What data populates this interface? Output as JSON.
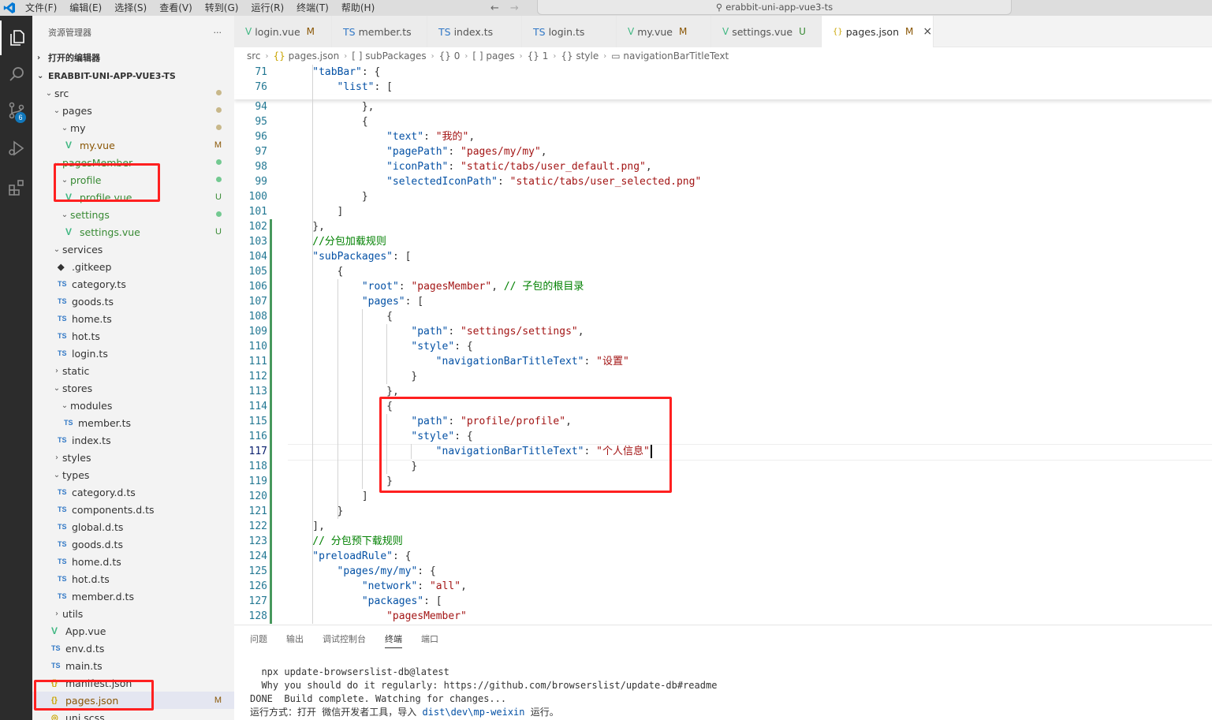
{
  "menubar": {
    "items": [
      "文件(F)",
      "编辑(E)",
      "选择(S)",
      "查看(V)",
      "转到(G)",
      "运行(R)",
      "终端(T)",
      "帮助(H)"
    ],
    "search_text": "erabbit-uni-app-vue3-ts"
  },
  "activity": {
    "scm_badge": "6"
  },
  "sidebar": {
    "title": "资源管理器",
    "more": "···",
    "open_editors": "打开的编辑器",
    "project": "ERABBIT-UNI-APP-VUE3-TS",
    "items": [
      {
        "label": "src",
        "status": "dot"
      },
      {
        "label": "pages",
        "status": "dot"
      },
      {
        "label": "my",
        "status": "dot"
      },
      {
        "label": "my.vue",
        "status": "M"
      },
      {
        "label": "pagesMember",
        "status": "dotg"
      },
      {
        "label": "profile",
        "status": "dotg"
      },
      {
        "label": "profile.vue",
        "status": "U"
      },
      {
        "label": "settings",
        "status": "dotg"
      },
      {
        "label": "settings.vue",
        "status": "U"
      },
      {
        "label": "services",
        "status": ""
      },
      {
        "label": ".gitkeep",
        "status": ""
      },
      {
        "label": "category.ts",
        "status": ""
      },
      {
        "label": "goods.ts",
        "status": ""
      },
      {
        "label": "home.ts",
        "status": ""
      },
      {
        "label": "hot.ts",
        "status": ""
      },
      {
        "label": "login.ts",
        "status": ""
      },
      {
        "label": "static",
        "status": ""
      },
      {
        "label": "stores",
        "status": ""
      },
      {
        "label": "modules",
        "status": ""
      },
      {
        "label": "member.ts",
        "status": ""
      },
      {
        "label": "index.ts",
        "status": ""
      },
      {
        "label": "styles",
        "status": ""
      },
      {
        "label": "types",
        "status": ""
      },
      {
        "label": "category.d.ts",
        "status": ""
      },
      {
        "label": "components.d.ts",
        "status": ""
      },
      {
        "label": "global.d.ts",
        "status": ""
      },
      {
        "label": "goods.d.ts",
        "status": ""
      },
      {
        "label": "home.d.ts",
        "status": ""
      },
      {
        "label": "hot.d.ts",
        "status": ""
      },
      {
        "label": "member.d.ts",
        "status": ""
      },
      {
        "label": "utils",
        "status": ""
      },
      {
        "label": "App.vue",
        "status": ""
      },
      {
        "label": "env.d.ts",
        "status": ""
      },
      {
        "label": "main.ts",
        "status": ""
      },
      {
        "label": "manifest.json",
        "status": ""
      },
      {
        "label": "pages.json",
        "status": "M"
      },
      {
        "label": "uni.scss",
        "status": ""
      }
    ]
  },
  "tabs": [
    {
      "label": "login.vue",
      "status": "M",
      "icon": "vue-icon"
    },
    {
      "label": "member.ts",
      "status": "",
      "icon": "ts-icon"
    },
    {
      "label": "index.ts",
      "status": "",
      "icon": "ts-icon"
    },
    {
      "label": "login.ts",
      "status": "",
      "icon": "ts-icon"
    },
    {
      "label": "my.vue",
      "status": "M",
      "icon": "vue-icon"
    },
    {
      "label": "settings.vue",
      "status": "U",
      "icon": "vue-icon"
    },
    {
      "label": "pages.json",
      "status": "M",
      "icon": "json-icon"
    }
  ],
  "breadcrumb": [
    "src",
    "pages.json",
    "subPackages",
    "0",
    "pages",
    "1",
    "style",
    "navigationBarTitleText"
  ],
  "editor": {
    "sticky": [
      {
        "n": "71",
        "code": "\"tabBar\": {"
      },
      {
        "n": "76",
        "code": "\"list\": ["
      }
    ],
    "lines": [
      {
        "n": "94",
        "code": "},"
      },
      {
        "n": "95",
        "code": "{"
      },
      {
        "n": "96",
        "code": "\"text\": \"我的\","
      },
      {
        "n": "97",
        "code": "\"pagePath\": \"pages/my/my\","
      },
      {
        "n": "98",
        "code": "\"iconPath\": \"static/tabs/user_default.png\","
      },
      {
        "n": "99",
        "code": "\"selectedIconPath\": \"static/tabs/user_selected.png\""
      },
      {
        "n": "100",
        "code": "}"
      },
      {
        "n": "101",
        "code": "]"
      },
      {
        "n": "102",
        "code": "},"
      },
      {
        "n": "103",
        "code": "//分包加载规则"
      },
      {
        "n": "104",
        "code": "\"subPackages\": ["
      },
      {
        "n": "105",
        "code": "{"
      },
      {
        "n": "106",
        "code": "\"root\": \"pagesMember\", // 子包的根目录"
      },
      {
        "n": "107",
        "code": "\"pages\": ["
      },
      {
        "n": "108",
        "code": "{"
      },
      {
        "n": "109",
        "code": "\"path\": \"settings/settings\","
      },
      {
        "n": "110",
        "code": "\"style\": {"
      },
      {
        "n": "111",
        "code": "\"navigationBarTitleText\": \"设置\""
      },
      {
        "n": "112",
        "code": "}"
      },
      {
        "n": "113",
        "code": "},"
      },
      {
        "n": "114",
        "code": "{"
      },
      {
        "n": "115",
        "code": "\"path\": \"profile/profile\","
      },
      {
        "n": "116",
        "code": "\"style\": {"
      },
      {
        "n": "117",
        "code": "\"navigationBarTitleText\": \"个人信息\""
      },
      {
        "n": "118",
        "code": "}"
      },
      {
        "n": "119",
        "code": "}"
      },
      {
        "n": "120",
        "code": "]"
      },
      {
        "n": "121",
        "code": "}"
      },
      {
        "n": "122",
        "code": "],"
      },
      {
        "n": "123",
        "code": "// 分包预下载规则"
      },
      {
        "n": "124",
        "code": "\"preloadRule\": {"
      },
      {
        "n": "125",
        "code": "\"pages/my/my\": {"
      },
      {
        "n": "126",
        "code": "\"network\": \"all\","
      },
      {
        "n": "127",
        "code": "\"packages\": ["
      },
      {
        "n": "128",
        "code": "\"pagesMember\""
      }
    ],
    "current_line": "117"
  },
  "panel": {
    "tabs": [
      "问题",
      "输出",
      "调试控制台",
      "终端",
      "端口"
    ],
    "active_tab": "终端",
    "terminal": [
      "  npx update-browserslist-db@latest",
      "  Why you should do it regularly: https://github.com/browserslist/update-db#readme",
      "DONE  Build complete. Watching for changes...",
      "运行方式：打开 微信开发者工具，导入 dist\\dev\\mp-weixin 运行。"
    ]
  },
  "colors": {
    "annotation_red": "#ff2020",
    "json_key": "#0451a5",
    "json_string": "#a31515",
    "comment": "#008000",
    "modified": "#895503",
    "untracked": "#388a34"
  }
}
